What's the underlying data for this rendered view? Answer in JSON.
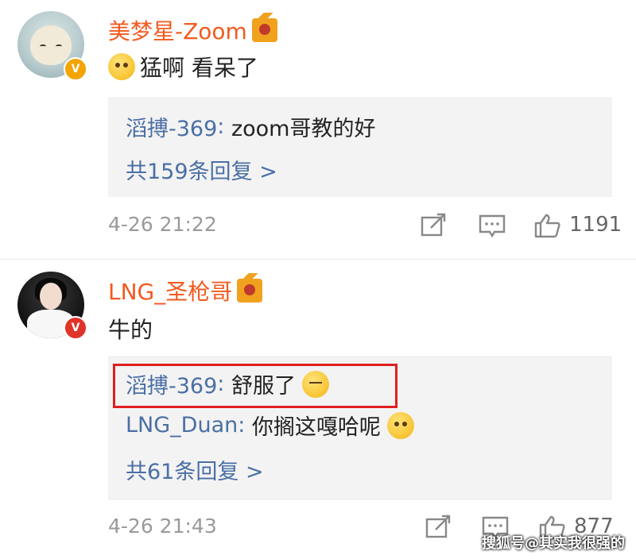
{
  "comments": [
    {
      "username": "美梦星-Zoom",
      "badge": "V",
      "content_text": "猛啊 看呆了",
      "replies": [
        {
          "user": "滔搏-369",
          "text": "zoom哥教的好"
        }
      ],
      "more_replies": "共159条回复 >",
      "time": "4-26 21:22",
      "likes": "1191"
    },
    {
      "username": "LNG_圣枪哥",
      "badge": "V",
      "content_text": "牛的",
      "replies": [
        {
          "user": "滔搏-369",
          "text": "舒服了"
        },
        {
          "user": "LNG_Duan",
          "text": "你搁这嘎哈呢"
        }
      ],
      "more_replies": "共61条回复 >",
      "time": "4-26 21:43",
      "likes": "877"
    }
  ],
  "icons": [
    "share-icon",
    "comment-icon",
    "like-icon",
    "crown-badge-icon",
    "verified-badge-icon"
  ],
  "colors": {
    "username": "#f25a1f",
    "reply_user": "#4a6fa5",
    "highlight": "#e01f1f",
    "reply_bg": "#f3f3f3"
  },
  "watermark": "搜狐号@其实我很强的"
}
